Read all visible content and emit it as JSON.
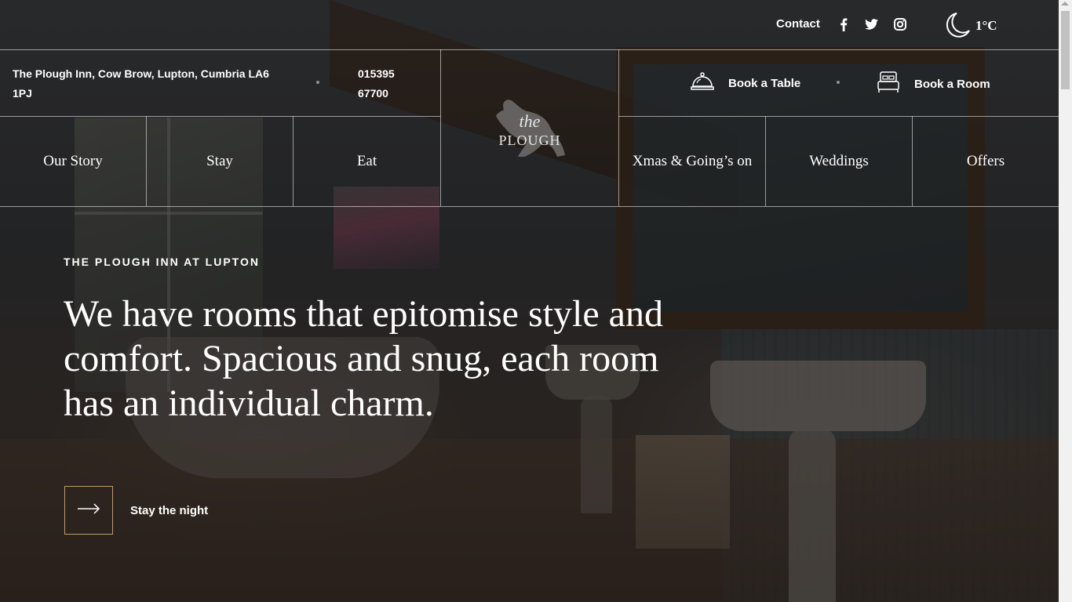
{
  "topbar": {
    "contact_label": "Contact",
    "social": [
      "facebook-icon",
      "twitter-icon",
      "instagram-icon"
    ],
    "weather_icon": "moon-icon",
    "temperature": "1°C"
  },
  "info": {
    "address": "The Plough Inn, Cow Brow, Lupton, Cumbria LA6 1PJ",
    "phone": "015395 67700"
  },
  "logo": {
    "line1": "the",
    "line2": "PLOUGH"
  },
  "booking": {
    "table_label": "Book a Table",
    "room_label": "Book a Room"
  },
  "nav": {
    "items": [
      "Our Story",
      "Stay",
      "Eat",
      "Xmas & Going’s on",
      "Weddings",
      "Offers"
    ]
  },
  "hero": {
    "eyebrow": "THE PLOUGH INN AT LUPTON",
    "headline": "We have rooms that epitomise style and comfort. Spacious and snug, each room has an individual charm.",
    "cta_label": "Stay the night",
    "accent_color": "#c19a6b"
  }
}
